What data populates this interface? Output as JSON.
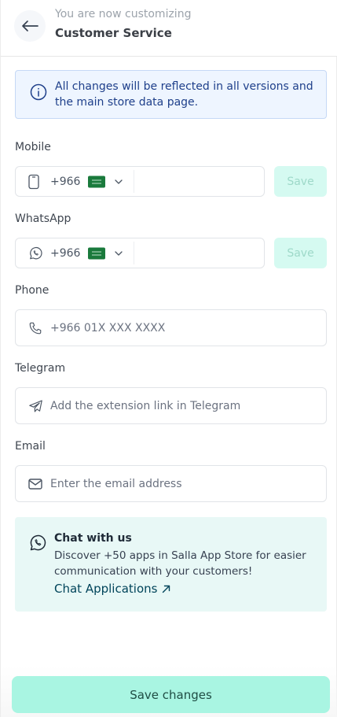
{
  "header": {
    "subtitle": "You are now customizing",
    "title": "Customer Service"
  },
  "notice": {
    "text": "All changes will be reflected in all versions and the main store data page."
  },
  "mobile": {
    "label": "Mobile",
    "country_code": "+966",
    "save_label": "Save"
  },
  "whatsapp": {
    "label": "WhatsApp",
    "country_code": "+966",
    "save_label": "Save"
  },
  "phone": {
    "label": "Phone",
    "placeholder": "+966 01X XXX XXXX"
  },
  "telegram": {
    "label": "Telegram",
    "placeholder": "Add the extension link in Telegram"
  },
  "email": {
    "label": "Email",
    "placeholder": "Enter the email address"
  },
  "chat": {
    "title": "Chat with us",
    "description": "Discover +50 apps in Salla App Store for easier communication with your customers!",
    "link_label": "Chat Applications"
  },
  "footer": {
    "save_changes_label": "Save changes"
  },
  "colors": {
    "notice_bg": "#eef5ff",
    "notice_text": "#1e3f8a",
    "save_disabled_bg": "#d5faf1",
    "primary_button_bg": "#a9f5e2",
    "chat_card_bg": "#e8f8f6",
    "link_color": "#00445a"
  },
  "icons": {
    "back": "arrow-left-icon",
    "info": "info-icon",
    "mobile": "smartphone-icon",
    "whatsapp": "whatsapp-icon",
    "flag": "saudi-flag-icon",
    "chevron": "chevron-down-icon",
    "phone": "phone-icon",
    "telegram": "telegram-icon",
    "email": "envelope-icon",
    "external": "arrow-up-right-icon"
  }
}
